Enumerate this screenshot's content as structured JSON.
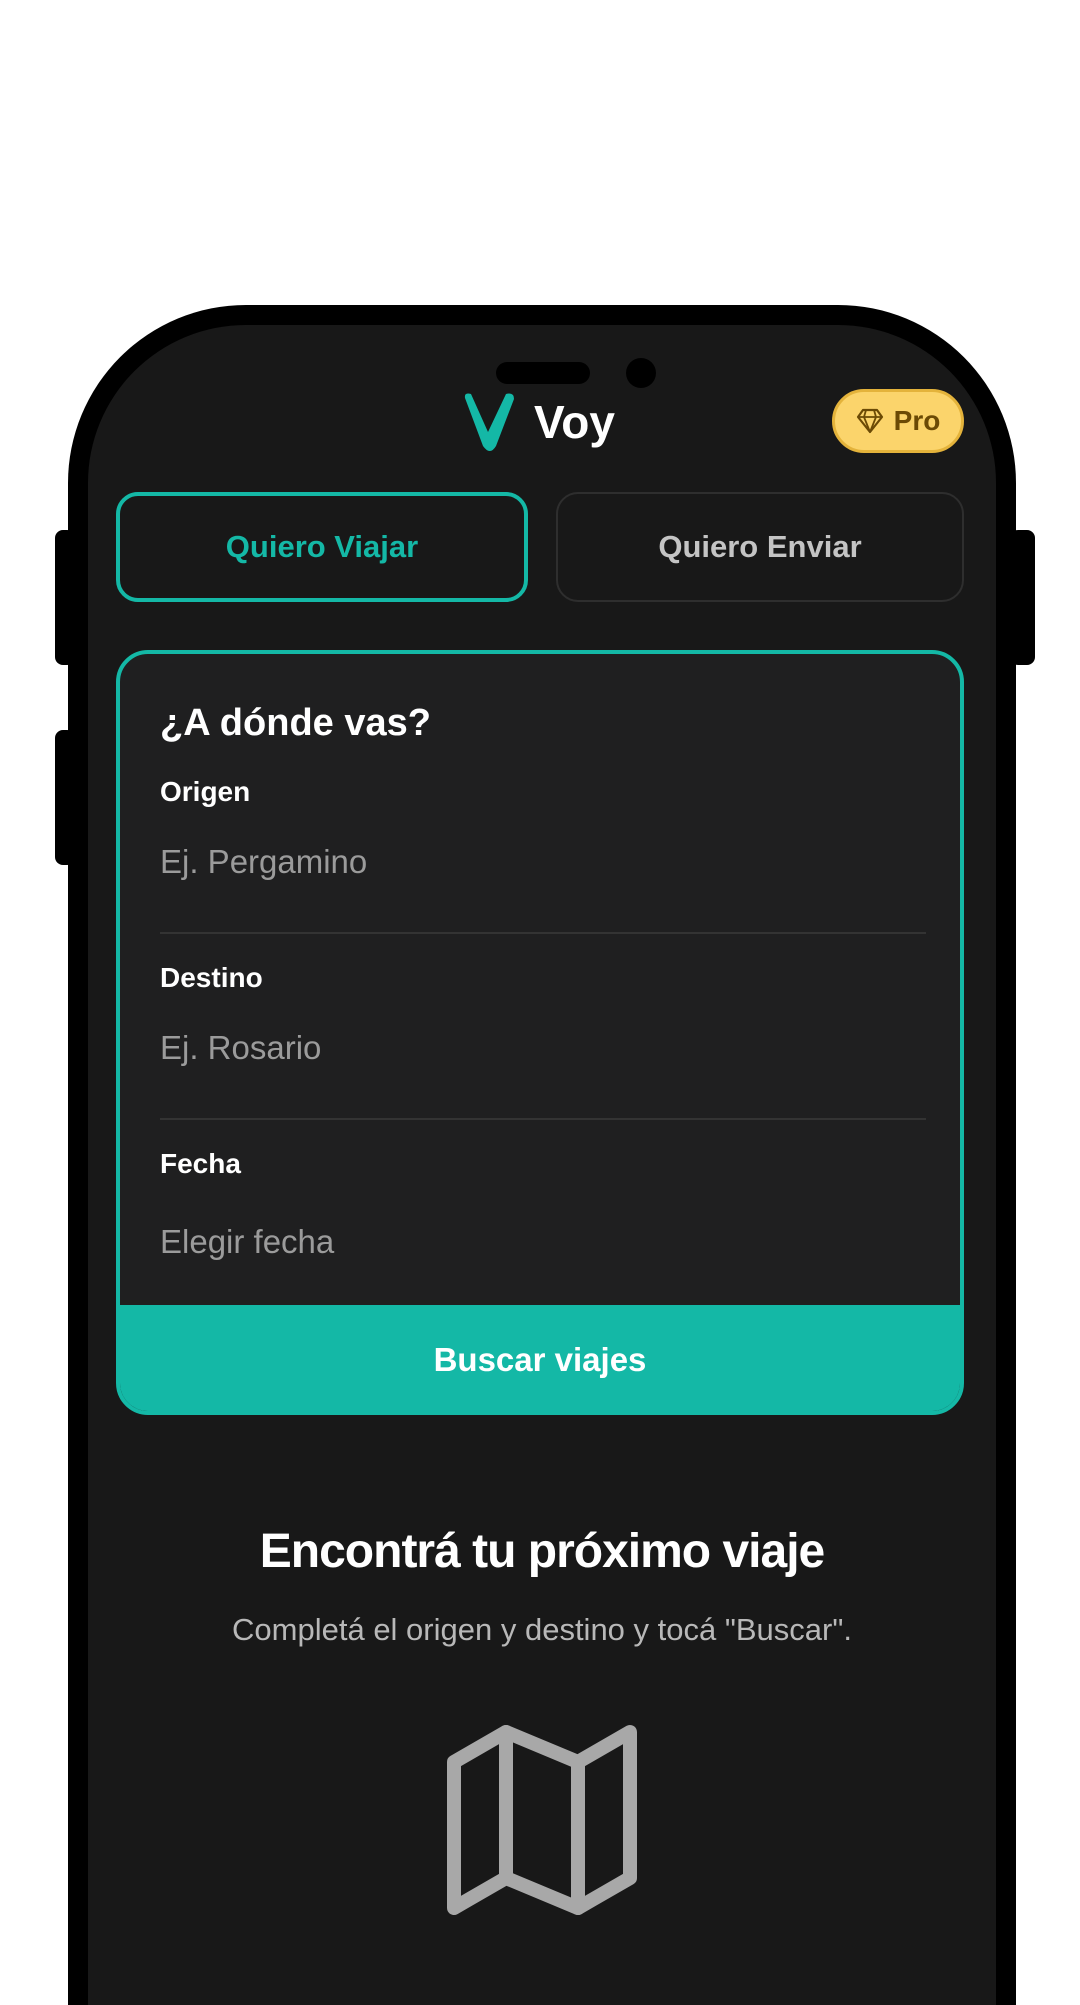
{
  "app": {
    "name": "Voy",
    "pro_badge": "Pro",
    "accent_color": "#14b8a6",
    "pro_color": "#fbd46b"
  },
  "tabs": [
    {
      "label": "Quiero Viajar",
      "active": true
    },
    {
      "label": "Quiero Enviar",
      "active": false
    }
  ],
  "search": {
    "title": "¿A dónde vas?",
    "origin": {
      "label": "Origen",
      "value": "",
      "placeholder": "Ej. Pergamino"
    },
    "destination": {
      "label": "Destino",
      "value": "",
      "placeholder": "Ej. Rosario"
    },
    "date": {
      "label": "Fecha",
      "value": "",
      "placeholder": "Elegir fecha"
    },
    "button_label": "Buscar viajes"
  },
  "empty_state": {
    "title": "Encontrá tu próximo viaje",
    "subtitle": "Completá el origen y destino y tocá \"Buscar\".",
    "icon": "map-icon"
  }
}
